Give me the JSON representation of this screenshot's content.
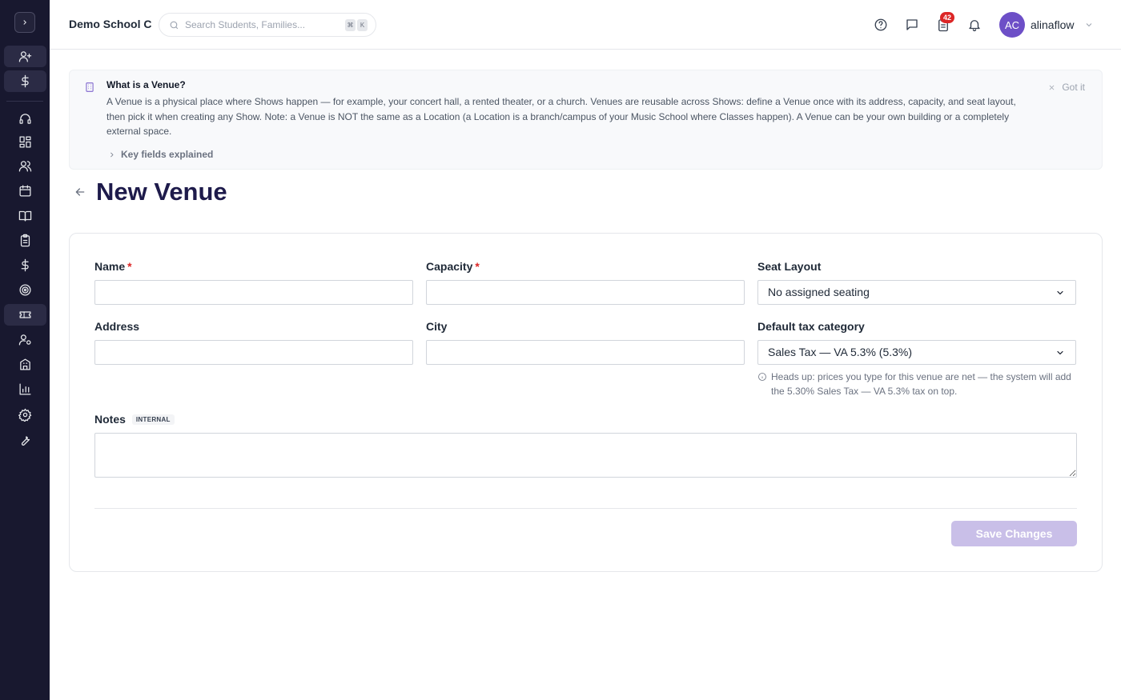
{
  "header": {
    "school_name": "Demo School C",
    "search_placeholder": "Search Students, Families...",
    "search_shortcut_1": "⌘",
    "search_shortcut_2": "K",
    "tasks_badge": "42",
    "user_initials": "AC",
    "username": "alinaflow"
  },
  "sidebar": {
    "items": [
      "add-user",
      "billing",
      "support",
      "dashboard",
      "students",
      "calendar",
      "courses",
      "attendance",
      "payments",
      "goals",
      "venues",
      "staff",
      "locations",
      "reports",
      "settings",
      "tools"
    ],
    "active": "venues"
  },
  "banner": {
    "title": "What is a Venue?",
    "text": "A Venue is a physical place where Shows happen — for example, your concert hall, a rented theater, or a church. Venues are reusable across Shows: define a Venue once with its address, capacity, and seat layout, then pick it when creating any Show. Note: a Venue is NOT the same as a Location (a Location is a branch/campus of your Music School where Classes happen). A Venue can be your own building or a completely external space.",
    "dismiss_label": "Got it",
    "key_fields_label": "Key fields explained"
  },
  "page": {
    "title": "New Venue"
  },
  "form": {
    "name_label": "Name",
    "name_value": "",
    "capacity_label": "Capacity",
    "capacity_value": "",
    "seat_layout_label": "Seat Layout",
    "seat_layout_value": "No assigned seating",
    "address_label": "Address",
    "address_value": "",
    "city_label": "City",
    "city_value": "",
    "tax_label": "Default tax category",
    "tax_value": "Sales Tax — VA 5.3% (5.3%)",
    "tax_hint": "Heads up: prices you type for this venue are net — the system will add the 5.30% Sales Tax — VA 5.3% tax on top.",
    "notes_label": "Notes",
    "notes_tag": "INTERNAL",
    "notes_value": "",
    "required_mark": "*",
    "save_label": "Save Changes"
  },
  "colors": {
    "sidebar_bg": "#18182f",
    "accent": "#6d4fc7",
    "title": "#1e1b4b",
    "required": "#dc2626",
    "save_disabled": "#c9bfe8"
  }
}
